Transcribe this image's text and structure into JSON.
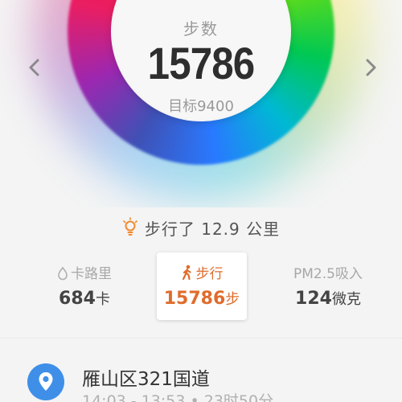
{
  "ring": {
    "title": "步数",
    "value": "15786",
    "goal": "目标9400",
    "progress": 1.68
  },
  "nav": {
    "prev_icon": "chevron-left-icon",
    "next_icon": "chevron-right-icon"
  },
  "summary": {
    "icon": "lightbulb-icon",
    "text": "步行了 12.9 公里"
  },
  "stats": {
    "calories": {
      "icon": "flame-icon",
      "label": "卡路里",
      "value": "684",
      "unit": "卡"
    },
    "walk": {
      "icon": "walking-person-icon",
      "label": "步行",
      "value": "15786",
      "unit": "步"
    },
    "pm25": {
      "label": "PM2.5吸入",
      "value": "124",
      "unit": "微克"
    }
  },
  "timeline": {
    "icon": "location-pin-icon",
    "title": "雁山区321国道",
    "time": "14:03 - 13:53 • 23时50分"
  },
  "colors": {
    "accent_orange": "#e06c2c",
    "location_blue": "#3f8fe8"
  }
}
